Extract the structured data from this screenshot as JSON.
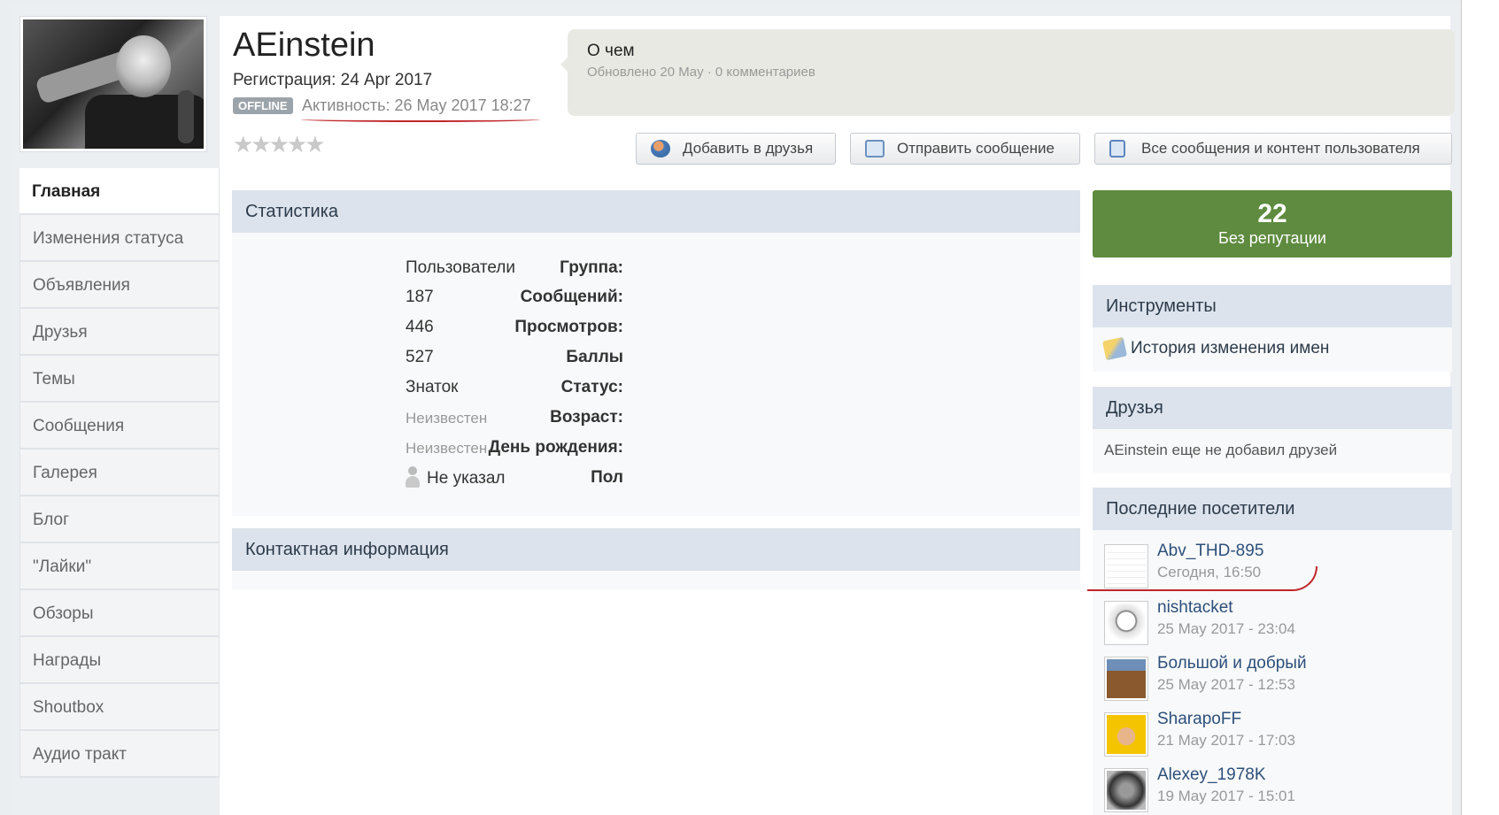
{
  "profile": {
    "username": "AEinstein",
    "registration": "Регистрация: 24 Apr 2017",
    "status_badge": "OFFLINE",
    "activity": "Активность: 26 May 2017 18:27",
    "rating_stars": 5
  },
  "about": {
    "title": "О чем",
    "subtitle": "Обновлено 20 May · 0 комментариев"
  },
  "actions": {
    "add_friend": "Добавить в друзья",
    "send_message": "Отправить сообщение",
    "all_content": "Все сообщения и контент пользователя"
  },
  "nav": {
    "items": [
      {
        "label": "Главная"
      },
      {
        "label": "Изменения статуса"
      },
      {
        "label": "Объявления"
      },
      {
        "label": "Друзья"
      },
      {
        "label": "Темы"
      },
      {
        "label": "Сообщения"
      },
      {
        "label": "Галерея"
      },
      {
        "label": "Блог"
      },
      {
        "label": "\"Лайки\""
      },
      {
        "label": "Обзоры"
      },
      {
        "label": "Награды"
      },
      {
        "label": "Shoutbox"
      },
      {
        "label": "Аудио тракт"
      }
    ]
  },
  "stats": {
    "title": "Статистика",
    "rows": [
      {
        "key": "Группа:",
        "value": "Пользователи"
      },
      {
        "key": "Сообщений:",
        "value": "187"
      },
      {
        "key": "Просмотров:",
        "value": "446"
      },
      {
        "key": "Баллы",
        "value": "527"
      },
      {
        "key": "Статус:",
        "value": "Знаток"
      },
      {
        "key": "Возраст:",
        "value": "Неизвестен"
      },
      {
        "key": "День рождения:",
        "value": "Неизвестен"
      },
      {
        "key": "Пол",
        "value": "Не указал"
      }
    ]
  },
  "contact": {
    "title": "Контактная информация"
  },
  "reputation": {
    "count": "22",
    "label": "Без репутации",
    "color": "#5e8b3f"
  },
  "tools": {
    "title": "Инструменты",
    "link": "История изменения имен"
  },
  "friends": {
    "title": "Друзья",
    "empty_text": "AEinstein еще не добавил друзей"
  },
  "visitors": {
    "title": "Последние посетители",
    "items": [
      {
        "name": "Abv_THD-895",
        "time": "Сегодня, 16:50"
      },
      {
        "name": "nishtacket",
        "time": "25 May 2017 - 23:04"
      },
      {
        "name": "Большой и добрый",
        "time": "25 May 2017 - 12:53"
      },
      {
        "name": "SharapoFF",
        "time": "21 May 2017 - 17:03"
      },
      {
        "name": "Alexey_1978K",
        "time": "19 May 2017 - 15:01"
      }
    ]
  },
  "colors": {
    "accent_underline": "#c0262a",
    "section_header_bg": "#dce3ec"
  }
}
